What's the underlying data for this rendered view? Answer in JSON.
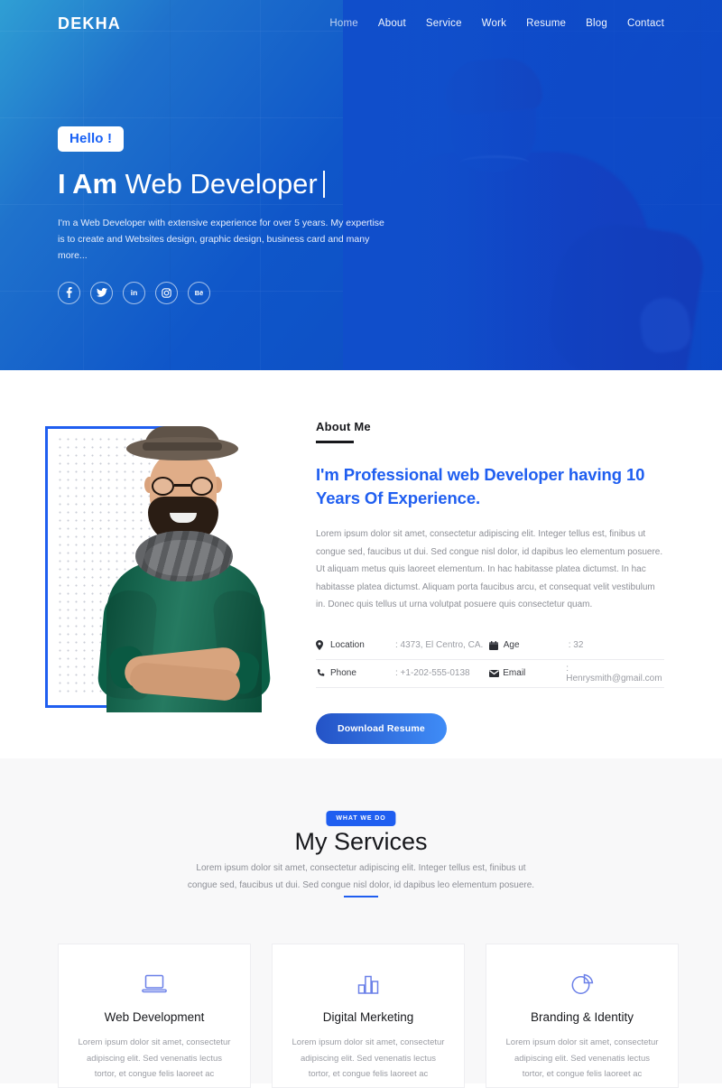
{
  "nav": {
    "brand": "DEKHA",
    "links": [
      {
        "label": "Home",
        "active": true
      },
      {
        "label": "About",
        "active": false
      },
      {
        "label": "Service",
        "active": false
      },
      {
        "label": "Work",
        "active": false
      },
      {
        "label": "Resume",
        "active": false
      },
      {
        "label": "Blog",
        "active": false
      },
      {
        "label": "Contact",
        "active": false
      }
    ]
  },
  "hero": {
    "badge": "Hello !",
    "title_bold": "I Am",
    "title_light": "Web Developer",
    "description": "I'm a Web Developer with extensive experience for over 5 years. My expertise is to create and Websites design, graphic design, business card and many more...",
    "socials": [
      {
        "name": "facebook",
        "label": "f"
      },
      {
        "name": "twitter",
        "label": ""
      },
      {
        "name": "linkedin",
        "label": "in"
      },
      {
        "name": "instagram",
        "label": ""
      },
      {
        "name": "behance",
        "label": "Bē"
      }
    ],
    "accent": "#1f5ef0"
  },
  "about": {
    "label": "About Me",
    "heading": "I'm Professional web Developer having 10 Years Of Experience.",
    "paragraph": "Lorem ipsum dolor sit amet, consectetur adipiscing elit. Integer tellus est, finibus ut congue sed, faucibus ut dui. Sed congue nisl dolor, id dapibus leo elementum posuere. Ut aliquam metus quis laoreet elementum. In hac habitasse platea dictumst. In hac habitasse platea dictumst. Aliquam porta faucibus arcu, et consequat velit vestibulum in. Donec quis tellus ut urna volutpat posuere quis consectetur quam.",
    "info": [
      {
        "icon": "location-pin-icon",
        "key": "Location",
        "value": ": 4373, El Centro, CA."
      },
      {
        "icon": "calendar-icon",
        "key": "Age",
        "value": ": 32"
      },
      {
        "icon": "phone-icon",
        "key": "Phone",
        "value": ": +1-202-555-0138"
      },
      {
        "icon": "envelope-icon",
        "key": "Email",
        "value": ": Henrysmith@gmail.com"
      }
    ],
    "button": "Download Resume"
  },
  "services": {
    "badge": "WHAT WE DO",
    "title": "My Services",
    "subtitle": "Lorem ipsum dolor sit amet, consectetur adipiscing elit. Integer tellus est, finibus ut congue sed, faucibus ut dui. Sed congue nisl dolor, id dapibus leo elementum posuere.",
    "cards": [
      {
        "icon": "laptop-icon",
        "title": "Web Development",
        "text": "Lorem ipsum dolor sit amet, consectetur adipiscing elit. Sed venenatis lectus tortor, et congue felis laoreet ac"
      },
      {
        "icon": "bar-chart-icon",
        "title": "Digital Merketing",
        "text": "Lorem ipsum dolor sit amet, consectetur adipiscing elit. Sed venenatis lectus tortor, et congue felis laoreet ac"
      },
      {
        "icon": "pie-chart-icon",
        "title": "Branding & Identity",
        "text": "Lorem ipsum dolor sit amet, consectetur adipiscing elit. Sed venenatis lectus tortor, et congue felis laoreet ac"
      }
    ]
  }
}
